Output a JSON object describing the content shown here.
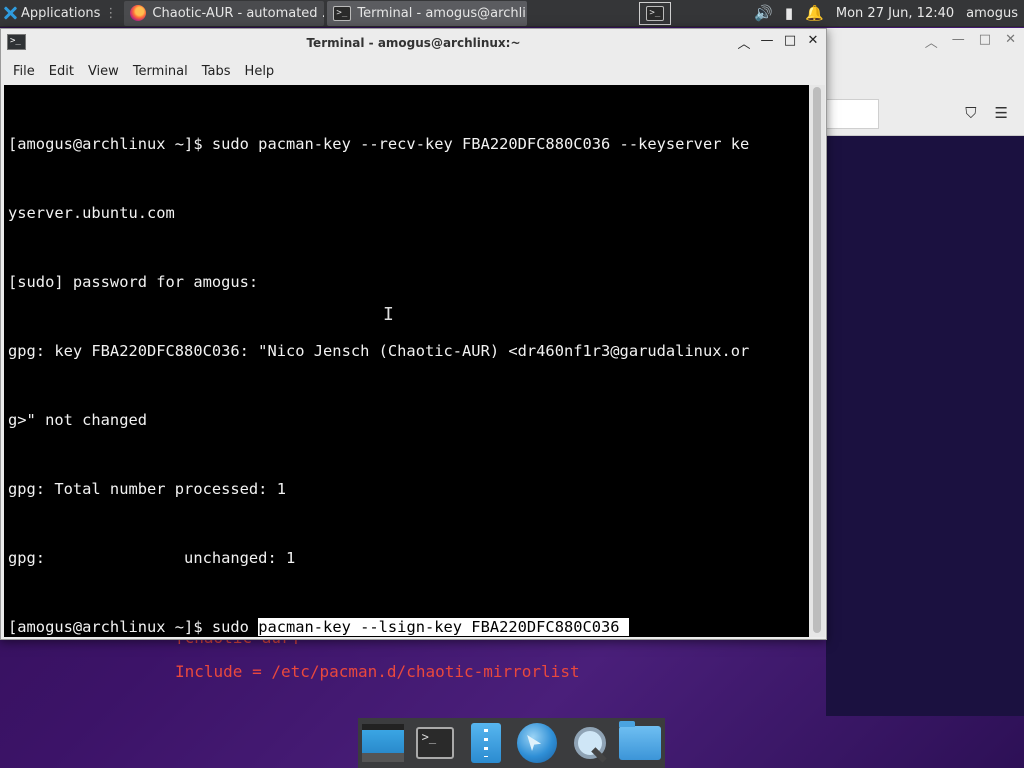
{
  "panel": {
    "apps_label": "Applications",
    "tasks": [
      {
        "label": "Chaotic-AUR - automated ..."
      },
      {
        "label": "Terminal - amogus@archli..."
      }
    ],
    "clock": "Mon 27 Jun, 12:40",
    "user": "amogus"
  },
  "window": {
    "title": "Terminal - amogus@archlinux:~",
    "menu": [
      "File",
      "Edit",
      "View",
      "Terminal",
      "Tabs",
      "Help"
    ]
  },
  "terminal": {
    "lines": [
      "[amogus@archlinux ~]$ sudo pacman-key --recv-key FBA220DFC880C036 --keyserver ke",
      "yserver.ubuntu.com",
      "[sudo] password for amogus:",
      "gpg: key FBA220DFC880C036: \"Nico Jensch (Chaotic-AUR) <dr460nf1r3@garudalinux.or",
      "g>\" not changed",
      "gpg: Total number processed: 1",
      "gpg:               unchanged: 1"
    ],
    "prompt": "[amogus@archlinux ~]$ sudo ",
    "selected_text": "pacman-key --lsign-key FBA220DFC880C036 "
  },
  "background": {
    "code_line_partial": "[chaotic-aur]",
    "code_line": "Include = /etc/pacman.d/chaotic-mirrorlist"
  },
  "dock": {
    "items": [
      "show-desktop",
      "terminal",
      "file-manager",
      "web-browser",
      "app-finder",
      "home-folder"
    ]
  }
}
